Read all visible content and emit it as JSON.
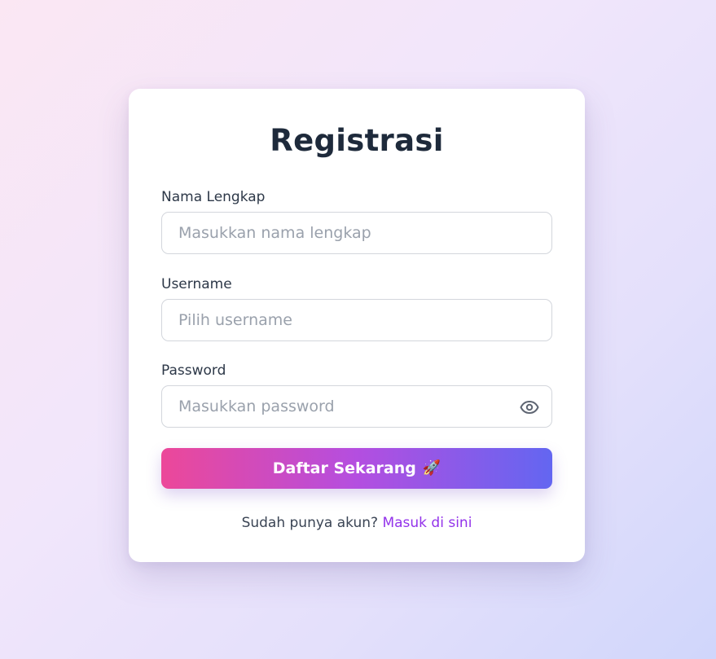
{
  "form": {
    "title": "Registrasi",
    "fields": [
      {
        "label": "Nama Lengkap",
        "placeholder": "Masukkan nama lengkap",
        "value": ""
      },
      {
        "label": "Username",
        "placeholder": "Pilih username",
        "value": ""
      },
      {
        "label": "Password",
        "placeholder": "Masukkan password",
        "value": ""
      }
    ],
    "submit_label": "Daftar Sekarang",
    "submit_emoji": "🚀",
    "footer_text": "Sudah punya akun?",
    "footer_link": "Masuk di sini"
  },
  "icons": {
    "password_toggle": "eye-icon",
    "submit_icon": "rocket-icon"
  },
  "colors": {
    "title": "#1e2a3b",
    "link": "#9333ea",
    "button_gradient_start": "#ec4899",
    "button_gradient_end": "#6366f1",
    "placeholder": "#9aa1ac"
  }
}
